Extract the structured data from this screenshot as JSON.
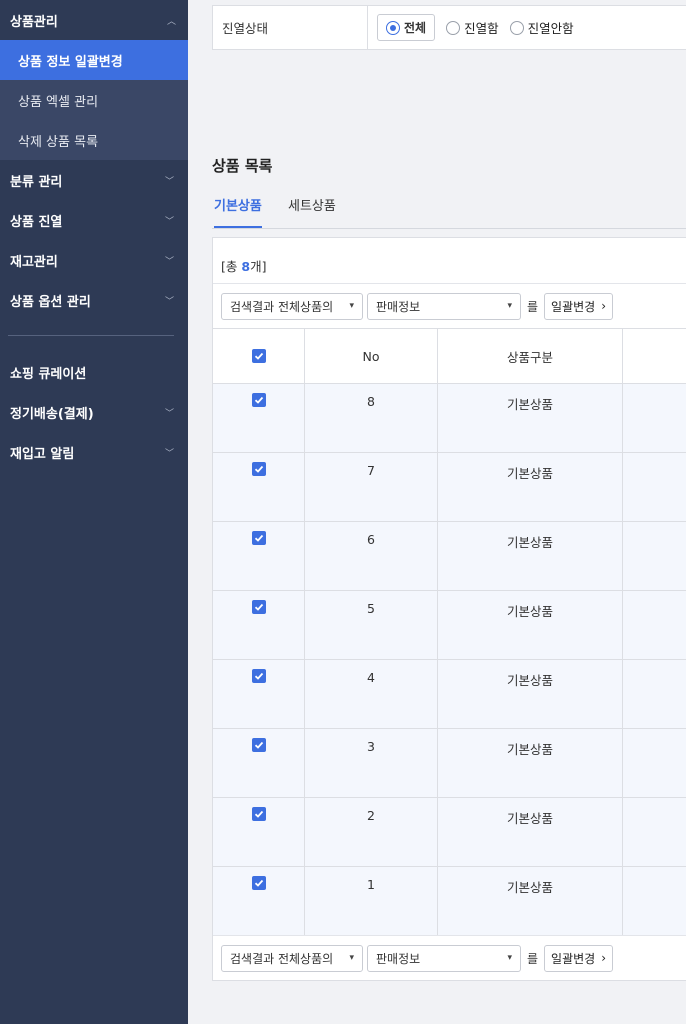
{
  "sidebar": {
    "section": {
      "label": "상품관리",
      "chevron": "chevron-up-icon"
    },
    "subitems": [
      {
        "label": "상품 정보 일괄변경",
        "active": true
      },
      {
        "label": "상품 엑셀 관리"
      },
      {
        "label": "삭제 상품 목록"
      }
    ],
    "items": [
      {
        "label": "분류 관리"
      },
      {
        "label": "상품 진열"
      },
      {
        "label": "재고관리"
      },
      {
        "label": "상품 옵션 관리"
      }
    ],
    "items2": [
      {
        "label": "쇼핑 큐레이션"
      },
      {
        "label": "정기배송(결제)"
      },
      {
        "label": "재입고 알림"
      }
    ]
  },
  "filter": {
    "label": "진열상태",
    "options": [
      "전체",
      "진열함",
      "진열안함"
    ],
    "selected": "전체"
  },
  "list": {
    "title": "상품 목록",
    "tabs": [
      "기본상품",
      "세트상품"
    ],
    "active_tab": "기본상품",
    "count_prefix": "[총 ",
    "count": "8",
    "count_suffix": "개]"
  },
  "bulk": {
    "scope": "검색결과 전체상품의",
    "field": "판매정보",
    "particle": "를",
    "button": "일괄변경"
  },
  "table": {
    "headers": {
      "no": "No",
      "type": "상품구분"
    },
    "rows": [
      {
        "no": "8",
        "type": "기본상품"
      },
      {
        "no": "7",
        "type": "기본상품"
      },
      {
        "no": "6",
        "type": "기본상품"
      },
      {
        "no": "5",
        "type": "기본상품"
      },
      {
        "no": "4",
        "type": "기본상품"
      },
      {
        "no": "3",
        "type": "기본상품"
      },
      {
        "no": "2",
        "type": "기본상품"
      },
      {
        "no": "1",
        "type": "기본상품"
      }
    ]
  },
  "colors": {
    "sidebar": "#2e3a55",
    "accent": "#3d6fe0",
    "row_bg": "#f4f7fd"
  }
}
